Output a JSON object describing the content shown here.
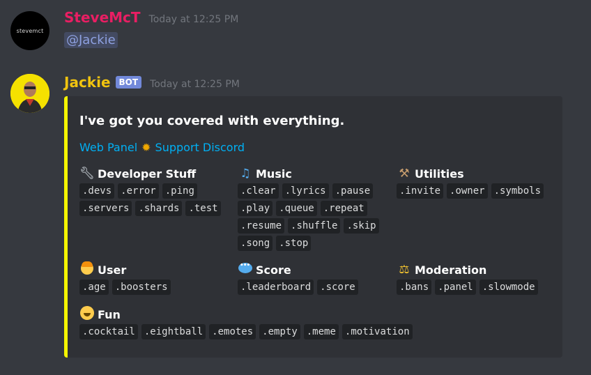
{
  "messages": [
    {
      "username": "SteveMcT",
      "timestamp": "Today at 12:25 PM",
      "avatar_text": "stevemct",
      "content_mention": "@Jackie"
    },
    {
      "username": "Jackie",
      "bot_tag": "BOT",
      "timestamp": "Today at 12:25 PM"
    }
  ],
  "embed": {
    "accent_color": "#f5f500",
    "title": "I've got you covered with everything.",
    "link_web_panel": "Web Panel",
    "link_sep_icon": "sun-emoji",
    "link_support": "Support Discord",
    "fields": [
      {
        "icon": "wrench-emoji",
        "name": "Developer Stuff",
        "commands": [
          ".devs",
          ".error",
          ".ping",
          ".servers",
          ".shards",
          ".test"
        ]
      },
      {
        "icon": "musical-notes-emoji",
        "name": "Music",
        "commands": [
          ".clear",
          ".lyrics",
          ".pause",
          ".play",
          ".queue",
          ".repeat",
          ".resume",
          ".shuffle",
          ".skip",
          ".song",
          ".stop"
        ]
      },
      {
        "icon": "hammer-emoji",
        "name": "Utilities",
        "commands": [
          ".invite",
          ".owner",
          ".symbols"
        ]
      },
      {
        "icon": "boy-emoji",
        "name": "User",
        "commands": [
          ".age",
          ".boosters"
        ]
      },
      {
        "icon": "speech-bubble-emoji",
        "name": "Score",
        "commands": [
          ".leaderboard",
          ".score"
        ]
      },
      {
        "icon": "scales-emoji",
        "name": "Moderation",
        "commands": [
          ".bans",
          ".panel",
          ".slowmode"
        ]
      },
      {
        "icon": "laughing-emoji",
        "name": "Fun",
        "commands": [
          ".cocktail",
          ".eightball",
          ".emotes",
          ".empty",
          ".meme",
          ".motivation"
        ]
      }
    ]
  },
  "colors": {
    "background": "#36393f",
    "embed_bg": "#2f3136",
    "user1": "#e91e63",
    "user2": "#f1c40f",
    "link": "#00b0f4",
    "bot_tag": "#7289da"
  }
}
